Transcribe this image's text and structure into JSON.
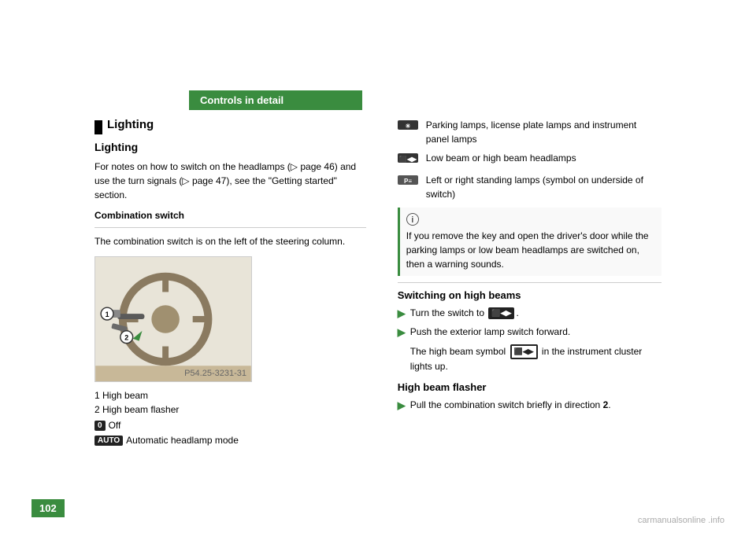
{
  "header": {
    "bar_label": "Controls in detail"
  },
  "left_col": {
    "section_title": "Lighting",
    "sub_title": "Lighting",
    "intro_text": "For notes on how to switch on the headlamps (▷ page 46) and use the turn signals (▷ page 47), see the \"Getting started\" section.",
    "combination_switch_label": "Combination switch",
    "combination_switch_desc": "The combination switch is on the left of the steering column.",
    "image_caption": "P54.25-3231-31",
    "caption_1": "1 High beam",
    "caption_2": "2 High beam flasher",
    "icon_0_label": "0",
    "icon_0_text": "Off",
    "icon_auto_label": "AUTO",
    "icon_auto_text": "Automatic headlamp mode"
  },
  "right_col_top": {
    "sym1_icon": "🚗",
    "sym1_text": "Parking lamps, license plate lamps and instrument panel lamps",
    "sym2_icon": "ID",
    "sym2_text": "Low beam or high beam headlamps",
    "sym3_icon": "PE",
    "sym3_text": "Left or right standing lamps (symbol on underside of switch)",
    "info_title": "ℹ",
    "info_text": "If you remove the key and open the driver's door while the parking lamps or low beam headlamps are switched on, then a warning sounds."
  },
  "right_col_bottom": {
    "high_beams_title": "Switching on high beams",
    "step1": "Turn the switch to",
    "step1_icon": "⬛◀▶",
    "step2": "Push the exterior lamp switch forward.",
    "step3_text": "The high beam symbol",
    "step3_icon": "⬛◀▶",
    "step3_suffix": "in the instrument cluster lights up.",
    "flasher_title": "High beam flasher",
    "flasher_step": "Pull the combination switch briefly in direction",
    "flasher_direction": "2",
    "direction_label": "2"
  },
  "page_number": "102",
  "watermark": "carmanualsonline .info"
}
